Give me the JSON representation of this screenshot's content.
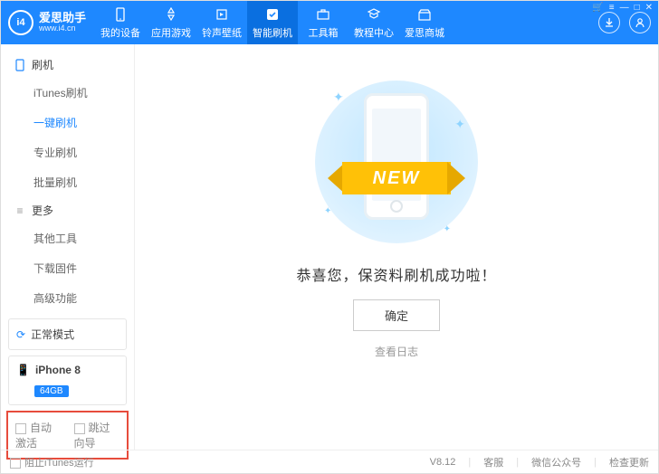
{
  "branding": {
    "name": "爱思助手",
    "site": "www.i4.cn",
    "mark": "i4"
  },
  "nav": {
    "items": [
      {
        "label": "我的设备",
        "icon": "device"
      },
      {
        "label": "应用游戏",
        "icon": "apps"
      },
      {
        "label": "铃声壁纸",
        "icon": "ringtone"
      },
      {
        "label": "智能刷机",
        "icon": "flash",
        "active": true
      },
      {
        "label": "工具箱",
        "icon": "toolbox"
      },
      {
        "label": "教程中心",
        "icon": "tutorial"
      },
      {
        "label": "爱思商城",
        "icon": "store"
      }
    ]
  },
  "sidebar": {
    "group1": {
      "title": "刷机"
    },
    "flash_items": [
      "iTunes刷机",
      "一键刷机",
      "专业刷机",
      "批量刷机"
    ],
    "flash_active_index": 1,
    "group2": {
      "title": "更多"
    },
    "more_items": [
      "其他工具",
      "下载固件",
      "高级功能"
    ],
    "status": {
      "label": "正常模式"
    },
    "device": {
      "name": "iPhone 8",
      "storage": "64GB"
    },
    "options": {
      "auto_activate": "自动激活",
      "skip_guide": "跳过向导"
    }
  },
  "main": {
    "ribbon": "NEW",
    "success_text": "恭喜您，保资料刷机成功啦！",
    "ok_button": "确定",
    "log_link": "查看日志"
  },
  "footer": {
    "block_itunes": "阻止iTunes运行",
    "version": "V8.12",
    "support": "客服",
    "wechat": "微信公众号",
    "update": "检查更新"
  }
}
